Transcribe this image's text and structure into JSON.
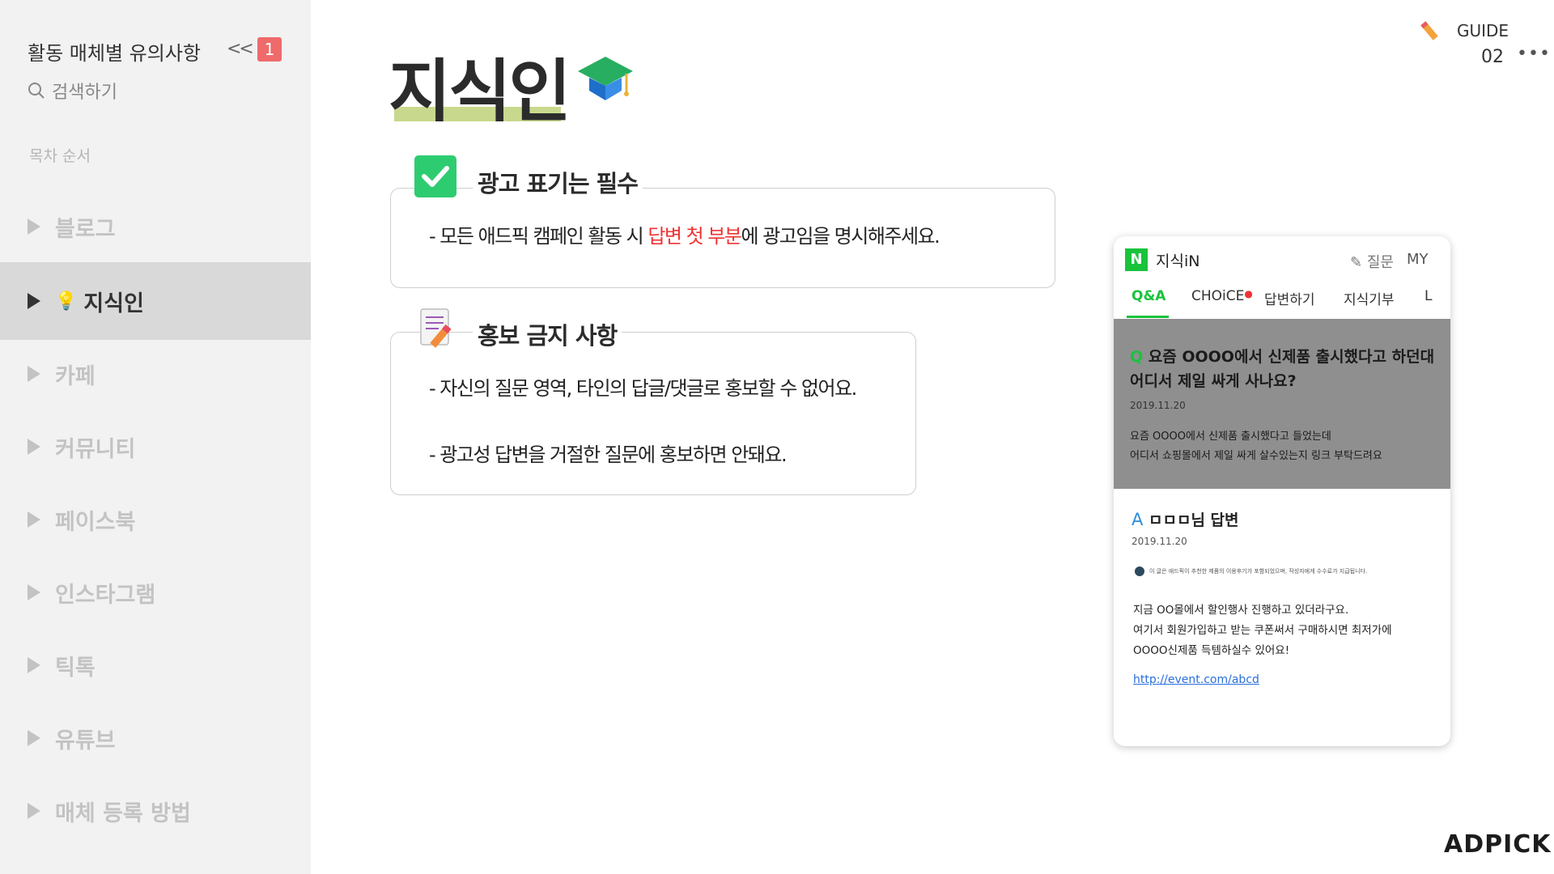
{
  "sidebar": {
    "title": "활동 매체별 유의사항",
    "collapse_label": "<<",
    "badge": "1",
    "search_label": "검색하기",
    "toc_label": "목차 순서",
    "items": [
      {
        "label": "블로그"
      },
      {
        "label": "지식인",
        "icon": "lightbulb-icon",
        "active": true
      },
      {
        "label": "카페"
      },
      {
        "label": "커뮤니티"
      },
      {
        "label": "페이스북"
      },
      {
        "label": "인스타그램"
      },
      {
        "label": "틱톡"
      },
      {
        "label": "유튜브"
      },
      {
        "label": "매체 등록 방법"
      }
    ]
  },
  "header": {
    "title": "지식인",
    "title_icon": "graduation-cap-icon",
    "guide_label": "GUIDE",
    "page_number": "02",
    "more_label": "•••"
  },
  "sections": {
    "ad_label": {
      "heading": "광고 표기는 필수",
      "icon": "checkbox-icon",
      "line_prefix": "- 모든 애드픽 캠페인 활동 시 ",
      "line_highlight": "답변 첫 부분",
      "line_suffix": "에 광고임을 명시해주세요.",
      "highlight_color": "#ee3333"
    },
    "promo_ban": {
      "heading": "홍보 금지 사항",
      "icon": "memo-icon",
      "lines": [
        "- 자신의 질문 영역, 타인의 답글/댓글로 홍보할 수 없어요.",
        "- 광고성 답변을 거절한 질문에 홍보하면 안돼요."
      ]
    }
  },
  "phone": {
    "logo_letter": "N",
    "brand": "지식iN",
    "ask_label": "질문",
    "my_label": "MY",
    "tabs": [
      "Q&A",
      "CHOiCE",
      "답변하기",
      "지식기부",
      "L"
    ],
    "question": {
      "mark": "Q",
      "title": "요즘 OOOO에서 신제품 출시했다고 하던대 어디서 제일 싸게 사나요?",
      "date": "2019.11.20",
      "body_lines": [
        "요즘 OOOO에서 신제품 출시했다고 들었는데",
        "어디서 쇼핑몰에서 제일 싸게 살수있는지 링크 부탁드려요"
      ]
    },
    "answer": {
      "mark": "A",
      "title": "ㅁㅁㅁ님 답변",
      "date": "2019.11.20",
      "notice": "이 글은 애드픽이 추천한 제품의 이용후기가 포함되었으며, 작성자에게 수수료가 지급됩니다.",
      "body_lines": [
        "지금 OO몰에서 할인행사 진행하고 있더라구요.",
        "여기서 회원가입하고 받는 쿠폰써서 구매하시면 최저가에",
        "OOOO신제품 득템하실수 있어요!"
      ],
      "link": "http://event.com/abcd"
    },
    "accent_color": "#19c33c"
  },
  "brand_footer": "ADPICK"
}
